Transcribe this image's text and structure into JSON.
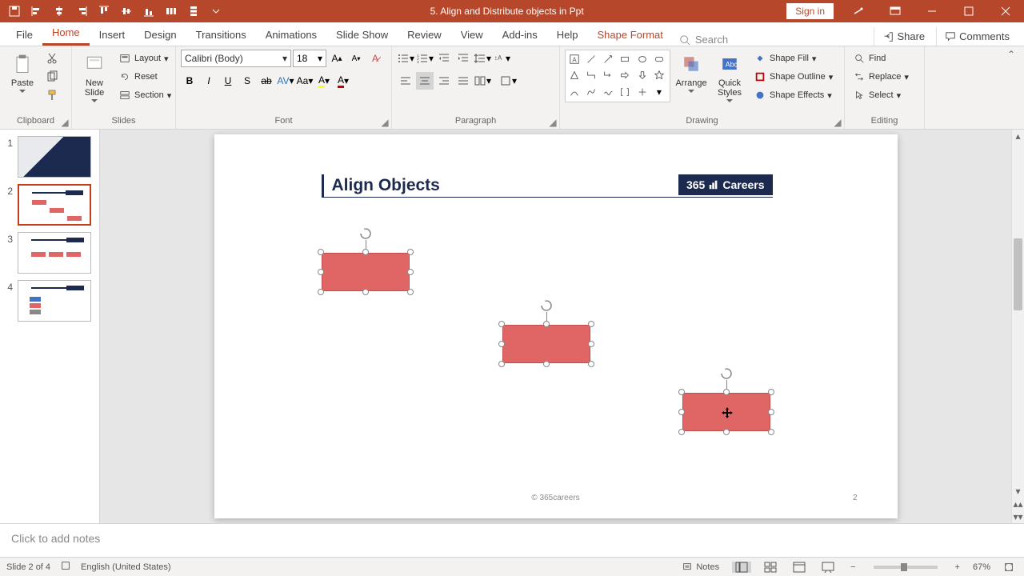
{
  "titlebar": {
    "title": "5. Align and Distribute objects in Ppt",
    "signin": "Sign in"
  },
  "tabs": {
    "file": "File",
    "home": "Home",
    "insert": "Insert",
    "design": "Design",
    "transitions": "Transitions",
    "animations": "Animations",
    "slideshow": "Slide Show",
    "review": "Review",
    "view": "View",
    "addins": "Add-ins",
    "help": "Help",
    "shapeformat": "Shape Format",
    "search_placeholder": "Search",
    "share": "Share",
    "comments": "Comments"
  },
  "ribbon": {
    "clipboard": {
      "label": "Clipboard",
      "paste": "Paste"
    },
    "slides": {
      "label": "Slides",
      "newslide": "New\nSlide",
      "layout": "Layout",
      "reset": "Reset",
      "section": "Section"
    },
    "font": {
      "label": "Font",
      "name": "Calibri (Body)",
      "size": "18"
    },
    "paragraph": {
      "label": "Paragraph"
    },
    "drawing": {
      "label": "Drawing",
      "arrange": "Arrange",
      "quickstyles": "Quick\nStyles",
      "shapefill": "Shape Fill",
      "shapeoutline": "Shape Outline",
      "shapeeffects": "Shape Effects"
    },
    "editing": {
      "label": "Editing",
      "find": "Find",
      "replace": "Replace",
      "select": "Select"
    }
  },
  "slide": {
    "title": "Align Objects",
    "brand_left": "365",
    "brand_right": "Careers",
    "copyright": "© 365careers",
    "page_num": "2"
  },
  "thumbs": [
    "1",
    "2",
    "3",
    "4"
  ],
  "notes": {
    "placeholder": "Click to add notes"
  },
  "status": {
    "slide_counter": "Slide 2 of 4",
    "language": "English (United States)",
    "notes": "Notes",
    "zoom": "67%"
  }
}
